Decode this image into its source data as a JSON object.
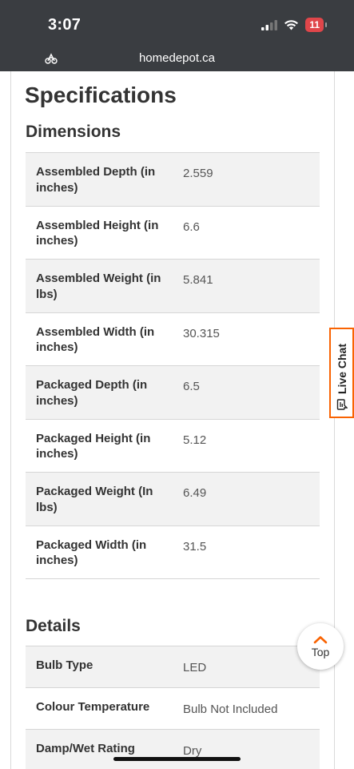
{
  "status_bar": {
    "time": "3:07",
    "battery": "11"
  },
  "browser": {
    "url": "homedepot.ca"
  },
  "page": {
    "title": "Specifications",
    "dimensions": {
      "heading": "Dimensions",
      "rows": [
        {
          "label": "Assembled Depth (in inches)",
          "value": "2.559"
        },
        {
          "label": "Assembled Height (in inches)",
          "value": "6.6"
        },
        {
          "label": "Assembled Weight (in lbs)",
          "value": "5.841"
        },
        {
          "label": "Assembled Width (in inches)",
          "value": "30.315"
        },
        {
          "label": "Packaged Depth (in inches)",
          "value": "6.5"
        },
        {
          "label": "Packaged Height (in inches)",
          "value": "5.12"
        },
        {
          "label": "Packaged Weight (In lbs)",
          "value": "6.49"
        },
        {
          "label": "Packaged Width (in inches)",
          "value": "31.5"
        }
      ]
    },
    "details": {
      "heading": "Details",
      "rows": [
        {
          "label": "Bulb Type",
          "value": "LED"
        },
        {
          "label": "Colour Temperature",
          "value": "Bulb Not Included"
        },
        {
          "label": "Damp/Wet Rating",
          "value": "Dry"
        }
      ]
    }
  },
  "live_chat": {
    "label": "Live Chat"
  },
  "back_to_top": {
    "label": "Top"
  },
  "colors": {
    "accent": "#f96302",
    "chrome": "#3a3d41",
    "row_shade": "#f2f2f2"
  }
}
